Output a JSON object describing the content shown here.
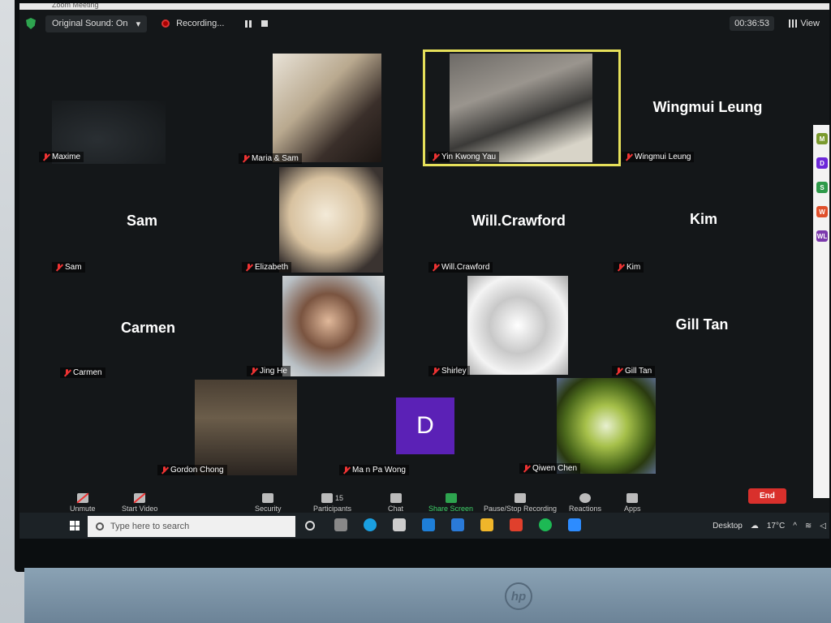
{
  "window": {
    "title": "Zoom Meeting"
  },
  "topbar": {
    "original_sound": "Original Sound: On",
    "recording": "Recording...",
    "timer": "00:36:53",
    "view": "View"
  },
  "tiles": {
    "maxime": {
      "label": "Maxime"
    },
    "maria_sam": {
      "label": "Maria & Sam"
    },
    "yin": {
      "label": "Yin Kwong Yau"
    },
    "wingmui": {
      "name": "Wingmui Leung",
      "label": "Wingmui Leung"
    },
    "sam": {
      "name": "Sam",
      "label": "Sam"
    },
    "elizabeth": {
      "label": "Elizabeth"
    },
    "will": {
      "name": "Will.Crawford",
      "label": "Will.Crawford"
    },
    "kim": {
      "name": "Kim",
      "label": "Kim"
    },
    "carmen": {
      "name": "Carmen",
      "label": "Carmen"
    },
    "jing": {
      "label": "Jing He"
    },
    "shirley": {
      "label": "Shirley"
    },
    "gill": {
      "name": "Gill Tan",
      "label": "Gill Tan"
    },
    "gordon": {
      "label": "Gordon Chong"
    },
    "manpa": {
      "initial": "D",
      "label": "Ma n Pa Wong"
    },
    "qiwen": {
      "label": "Qiwen Chen"
    }
  },
  "sidebar": {
    "avatars": [
      "M",
      "D",
      "S",
      "W",
      "WL"
    ]
  },
  "toolbar": {
    "unmute": "Unmute",
    "start_video": "Start Video",
    "security": "Security",
    "participants": "Participants",
    "participants_count": "15",
    "chat": "Chat",
    "share": "Share Screen",
    "pause_rec": "Pause/Stop Recording",
    "reactions": "Reactions",
    "apps": "Apps",
    "end": "End"
  },
  "taskbar": {
    "search_placeholder": "Type here to search",
    "desktop": "Desktop",
    "temp": "17°C"
  },
  "colors": {
    "accent_green": "#2ea44f",
    "end_red": "#d9302c",
    "active_speaker": "#e6e05a",
    "avatar_purple": "#5b21b6"
  }
}
